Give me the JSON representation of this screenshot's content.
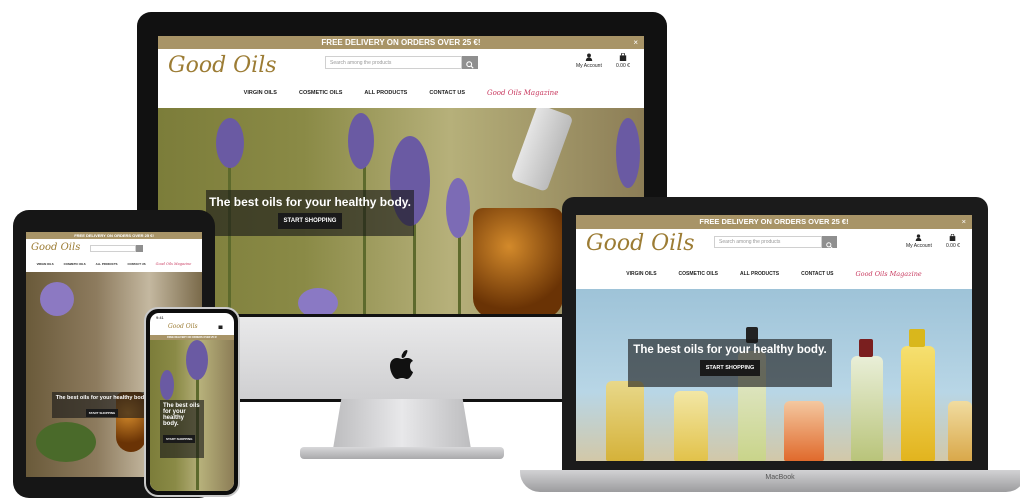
{
  "site": {
    "banner": "FREE DELIVERY ON ORDERS OVER 25 €!",
    "close_icon": "×",
    "logo": "Good Oils",
    "search_placeholder": "Search among the products",
    "account_label": "My Account",
    "cart_total": "0.00 €",
    "nav": [
      "VIRGIN OILS",
      "COSMETIC OILS",
      "ALL PRODUCTS",
      "CONTACT US",
      "Good Oils Magazine"
    ],
    "hero_text": "The best oils for your healthy body.",
    "hero_cta": "START SHOPPING"
  },
  "mobile": {
    "time": "9:41",
    "hero_lines": [
      "The best oils",
      "for your",
      "healthy",
      "body."
    ]
  },
  "devices": {
    "laptop_brand": "MacBook"
  },
  "icons": {
    "search": "search-icon",
    "account": "user-icon",
    "cart": "bag-icon",
    "close": "close-icon",
    "apple": "apple-logo-icon"
  },
  "colors": {
    "banner": "#a89467",
    "logo": "#9c7c34",
    "magazine": "#c8385e"
  }
}
